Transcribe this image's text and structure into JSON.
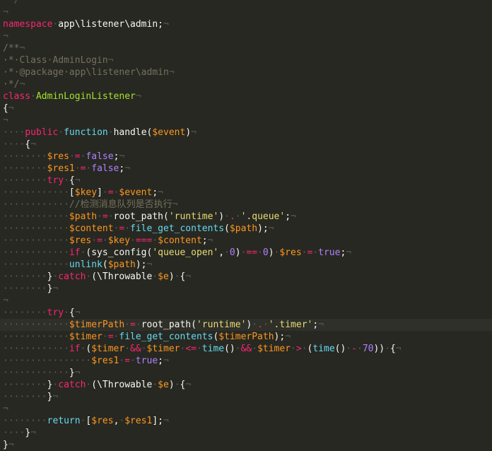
{
  "colors": {
    "background": "#272822",
    "text": "#f8f8f2",
    "keyword": "#f92672",
    "storage": "#66d9ef",
    "variable": "#fd971f",
    "string": "#e6db74",
    "comment": "#75715e",
    "constant": "#ae81ff",
    "function": "#a6e22e",
    "whitespace": "#5c5d55",
    "current_line": "#2f302a"
  },
  "lines": [
    {
      "t": [
        [
          "ws",
          " */"
        ]
      ]
    },
    {
      "t": [
        [
          "ws",
          "¬"
        ]
      ]
    },
    {
      "t": [
        [
          "kw",
          "namespace"
        ],
        [
          "ws",
          "·"
        ],
        [
          "tx",
          "app\\listener\\admin;"
        ],
        [
          "ws",
          "¬"
        ]
      ]
    },
    {
      "t": [
        [
          "ws",
          "¬"
        ]
      ]
    },
    {
      "t": [
        [
          "cm",
          "/**"
        ],
        [
          "ws",
          "¬"
        ]
      ]
    },
    {
      "t": [
        [
          "cm",
          "·*·Class·AdminLogin"
        ],
        [
          "ws",
          "¬"
        ]
      ]
    },
    {
      "t": [
        [
          "cm",
          "·*·@package·app\\listener\\admin"
        ],
        [
          "ws",
          "¬"
        ]
      ]
    },
    {
      "t": [
        [
          "cm",
          "·*/"
        ],
        [
          "ws",
          "¬"
        ]
      ]
    },
    {
      "t": [
        [
          "kw",
          "class"
        ],
        [
          "ws",
          "·"
        ],
        [
          "fn",
          "AdminLoginListener"
        ],
        [
          "ws",
          "¬"
        ]
      ]
    },
    {
      "t": [
        [
          "tx",
          "{"
        ],
        [
          "ws",
          "¬"
        ]
      ]
    },
    {
      "t": [
        [
          "ws",
          "¬"
        ]
      ]
    },
    {
      "t": [
        [
          "ws",
          "····"
        ],
        [
          "kw",
          "public"
        ],
        [
          "ws",
          "·"
        ],
        [
          "st",
          "function"
        ],
        [
          "ws",
          "·"
        ],
        [
          "tx",
          "handle("
        ],
        [
          "va",
          "$event"
        ],
        [
          "tx",
          ")"
        ],
        [
          "ws",
          "¬"
        ]
      ]
    },
    {
      "t": [
        [
          "ws",
          "····"
        ],
        [
          "tx",
          "{"
        ],
        [
          "ws",
          "¬"
        ]
      ]
    },
    {
      "t": [
        [
          "ws",
          "········"
        ],
        [
          "va",
          "$res"
        ],
        [
          "ws",
          "·"
        ],
        [
          "kw",
          "="
        ],
        [
          "ws",
          "·"
        ],
        [
          "co",
          "false"
        ],
        [
          "tx",
          ";"
        ],
        [
          "ws",
          "¬"
        ]
      ]
    },
    {
      "t": [
        [
          "ws",
          "········"
        ],
        [
          "va",
          "$res1"
        ],
        [
          "ws",
          "·"
        ],
        [
          "kw",
          "="
        ],
        [
          "ws",
          "·"
        ],
        [
          "co",
          "false"
        ],
        [
          "tx",
          ";"
        ],
        [
          "ws",
          "¬"
        ]
      ]
    },
    {
      "t": [
        [
          "ws",
          "········"
        ],
        [
          "kw",
          "try"
        ],
        [
          "ws",
          "·"
        ],
        [
          "tx",
          "{"
        ],
        [
          "ws",
          "¬"
        ]
      ]
    },
    {
      "t": [
        [
          "ws",
          "············"
        ],
        [
          "tx",
          "["
        ],
        [
          "va",
          "$key"
        ],
        [
          "tx",
          "]"
        ],
        [
          "ws",
          "·"
        ],
        [
          "kw",
          "="
        ],
        [
          "ws",
          "·"
        ],
        [
          "va",
          "$event"
        ],
        [
          "tx",
          ";"
        ],
        [
          "ws",
          "¬"
        ]
      ]
    },
    {
      "t": [
        [
          "ws",
          "············"
        ],
        [
          "cm",
          "//检测消息队列是否执行"
        ],
        [
          "ws",
          "¬"
        ]
      ]
    },
    {
      "t": [
        [
          "ws",
          "············"
        ],
        [
          "va",
          "$path"
        ],
        [
          "ws",
          "·"
        ],
        [
          "kw",
          "="
        ],
        [
          "ws",
          "·"
        ],
        [
          "tx",
          "root_path("
        ],
        [
          "str",
          "'runtime'"
        ],
        [
          "tx",
          ")"
        ],
        [
          "ws",
          "·"
        ],
        [
          "kw",
          "."
        ],
        [
          "ws",
          "·"
        ],
        [
          "str",
          "'.queue'"
        ],
        [
          "tx",
          ";"
        ],
        [
          "ws",
          "¬"
        ]
      ]
    },
    {
      "t": [
        [
          "ws",
          "············"
        ],
        [
          "va",
          "$content"
        ],
        [
          "ws",
          "·"
        ],
        [
          "kw",
          "="
        ],
        [
          "ws",
          "·"
        ],
        [
          "st",
          "file_get_contents"
        ],
        [
          "tx",
          "("
        ],
        [
          "va",
          "$path"
        ],
        [
          "tx",
          ");"
        ],
        [
          "ws",
          "¬"
        ]
      ]
    },
    {
      "t": [
        [
          "ws",
          "············"
        ],
        [
          "va",
          "$res"
        ],
        [
          "ws",
          "·"
        ],
        [
          "kw",
          "="
        ],
        [
          "ws",
          "·"
        ],
        [
          "va",
          "$key"
        ],
        [
          "ws",
          "·"
        ],
        [
          "kw",
          "==="
        ],
        [
          "ws",
          "·"
        ],
        [
          "va",
          "$content"
        ],
        [
          "tx",
          ";"
        ],
        [
          "ws",
          "¬"
        ]
      ]
    },
    {
      "t": [
        [
          "ws",
          "············"
        ],
        [
          "kw",
          "if"
        ],
        [
          "ws",
          "·"
        ],
        [
          "tx",
          "(sys_config("
        ],
        [
          "str",
          "'queue_open'"
        ],
        [
          "tx",
          ","
        ],
        [
          "ws",
          "·"
        ],
        [
          "co",
          "0"
        ],
        [
          "tx",
          ")"
        ],
        [
          "ws",
          "·"
        ],
        [
          "kw",
          "=="
        ],
        [
          "ws",
          "·"
        ],
        [
          "co",
          "0"
        ],
        [
          "tx",
          ")"
        ],
        [
          "ws",
          "·"
        ],
        [
          "va",
          "$res"
        ],
        [
          "ws",
          "·"
        ],
        [
          "kw",
          "="
        ],
        [
          "ws",
          "·"
        ],
        [
          "co",
          "true"
        ],
        [
          "tx",
          ";"
        ],
        [
          "ws",
          "¬"
        ]
      ]
    },
    {
      "t": [
        [
          "ws",
          "············"
        ],
        [
          "st",
          "unlink"
        ],
        [
          "tx",
          "("
        ],
        [
          "va",
          "$path"
        ],
        [
          "tx",
          ");"
        ],
        [
          "ws",
          "¬"
        ]
      ]
    },
    {
      "t": [
        [
          "ws",
          "········"
        ],
        [
          "tx",
          "}"
        ],
        [
          "ws",
          "·"
        ],
        [
          "kw",
          "catch"
        ],
        [
          "ws",
          "·"
        ],
        [
          "tx",
          "(\\Throwable"
        ],
        [
          "ws",
          "·"
        ],
        [
          "va",
          "$e"
        ],
        [
          "tx",
          ")"
        ],
        [
          "ws",
          "·"
        ],
        [
          "tx",
          "{"
        ],
        [
          "ws",
          "¬"
        ]
      ]
    },
    {
      "t": [
        [
          "ws",
          "········"
        ],
        [
          "tx",
          "}"
        ],
        [
          "ws",
          "¬"
        ]
      ]
    },
    {
      "t": [
        [
          "ws",
          "¬"
        ]
      ]
    },
    {
      "t": [
        [
          "ws",
          "········"
        ],
        [
          "kw",
          "try"
        ],
        [
          "ws",
          "·"
        ],
        [
          "tx",
          "{"
        ],
        [
          "ws",
          "¬"
        ]
      ]
    },
    {
      "cur": true,
      "t": [
        [
          "ws",
          "············"
        ],
        [
          "va",
          "$timerPath"
        ],
        [
          "ws",
          "·"
        ],
        [
          "kw",
          "="
        ],
        [
          "ws",
          "·"
        ],
        [
          "tx",
          "root_path("
        ],
        [
          "str",
          "'runtime'"
        ],
        [
          "tx",
          ")"
        ],
        [
          "ws",
          "·"
        ],
        [
          "kw",
          "."
        ],
        [
          "ws",
          "·"
        ],
        [
          "str",
          "'.timer'"
        ],
        [
          "tx",
          ";"
        ],
        [
          "ws",
          "¬"
        ]
      ]
    },
    {
      "t": [
        [
          "ws",
          "············"
        ],
        [
          "va",
          "$timer"
        ],
        [
          "ws",
          "·"
        ],
        [
          "kw",
          "="
        ],
        [
          "ws",
          "·"
        ],
        [
          "st",
          "file_get_contents"
        ],
        [
          "tx",
          "("
        ],
        [
          "va",
          "$timerPath"
        ],
        [
          "tx",
          ");"
        ],
        [
          "ws",
          "¬"
        ]
      ]
    },
    {
      "t": [
        [
          "ws",
          "············"
        ],
        [
          "kw",
          "if"
        ],
        [
          "ws",
          "·"
        ],
        [
          "tx",
          "("
        ],
        [
          "va",
          "$timer"
        ],
        [
          "ws",
          "·"
        ],
        [
          "kw",
          "&&"
        ],
        [
          "ws",
          "·"
        ],
        [
          "va",
          "$timer"
        ],
        [
          "ws",
          "·"
        ],
        [
          "kw",
          "<="
        ],
        [
          "ws",
          "·"
        ],
        [
          "st",
          "time"
        ],
        [
          "tx",
          "()"
        ],
        [
          "ws",
          "·"
        ],
        [
          "kw",
          "&&"
        ],
        [
          "ws",
          "·"
        ],
        [
          "va",
          "$timer"
        ],
        [
          "ws",
          "·"
        ],
        [
          "kw",
          ">"
        ],
        [
          "ws",
          "·"
        ],
        [
          "tx",
          "("
        ],
        [
          "st",
          "time"
        ],
        [
          "tx",
          "()"
        ],
        [
          "ws",
          "·"
        ],
        [
          "kw",
          "-"
        ],
        [
          "ws",
          "·"
        ],
        [
          "co",
          "70"
        ],
        [
          "tx",
          "))"
        ],
        [
          "ws",
          "·"
        ],
        [
          "tx",
          "{"
        ],
        [
          "ws",
          "¬"
        ]
      ]
    },
    {
      "t": [
        [
          "ws",
          "················"
        ],
        [
          "va",
          "$res1"
        ],
        [
          "ws",
          "·"
        ],
        [
          "kw",
          "="
        ],
        [
          "ws",
          "·"
        ],
        [
          "co",
          "true"
        ],
        [
          "tx",
          ";"
        ],
        [
          "ws",
          "¬"
        ]
      ]
    },
    {
      "t": [
        [
          "ws",
          "············"
        ],
        [
          "tx",
          "}"
        ],
        [
          "ws",
          "¬"
        ]
      ]
    },
    {
      "t": [
        [
          "ws",
          "········"
        ],
        [
          "tx",
          "}"
        ],
        [
          "ws",
          "·"
        ],
        [
          "kw",
          "catch"
        ],
        [
          "ws",
          "·"
        ],
        [
          "tx",
          "(\\Throwable"
        ],
        [
          "ws",
          "·"
        ],
        [
          "va",
          "$e"
        ],
        [
          "tx",
          ")"
        ],
        [
          "ws",
          "·"
        ],
        [
          "tx",
          "{"
        ],
        [
          "ws",
          "¬"
        ]
      ]
    },
    {
      "t": [
        [
          "ws",
          "········"
        ],
        [
          "tx",
          "}"
        ],
        [
          "ws",
          "¬"
        ]
      ]
    },
    {
      "t": [
        [
          "ws",
          "¬"
        ]
      ]
    },
    {
      "t": [
        [
          "ws",
          "········"
        ],
        [
          "st",
          "return"
        ],
        [
          "ws",
          "·"
        ],
        [
          "tx",
          "["
        ],
        [
          "va",
          "$res"
        ],
        [
          "tx",
          ","
        ],
        [
          "ws",
          "·"
        ],
        [
          "va",
          "$res1"
        ],
        [
          "tx",
          "];"
        ],
        [
          "ws",
          "¬"
        ]
      ]
    },
    {
      "t": [
        [
          "ws",
          "····"
        ],
        [
          "tx",
          "}"
        ],
        [
          "ws",
          "¬"
        ]
      ]
    },
    {
      "t": [
        [
          "tx",
          "}"
        ],
        [
          "ws",
          "¬"
        ]
      ]
    }
  ]
}
